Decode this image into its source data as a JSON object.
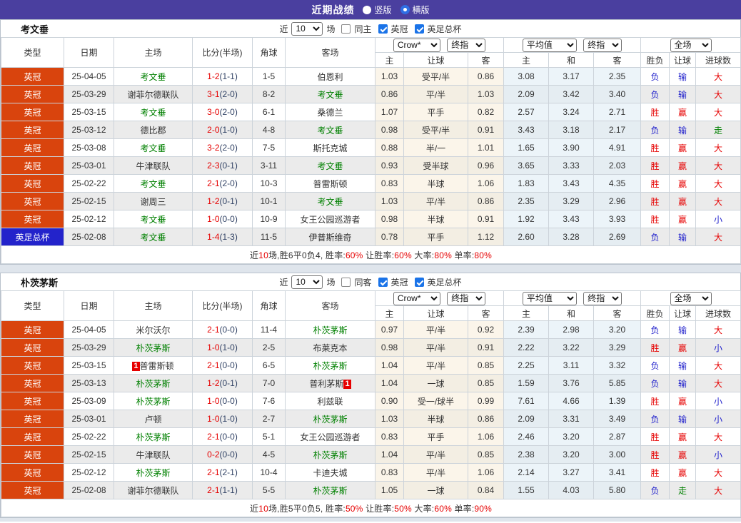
{
  "title_bar": {
    "title": "近期战绩",
    "radio_vertical_label": "竖版",
    "radio_horizontal_label": "横版",
    "selected_layout": "横版"
  },
  "controls": {
    "near_label": "近",
    "count_value": "10",
    "games_label": "场",
    "league_label": "英冠",
    "cup_label": "英足总杯"
  },
  "columns": {
    "type": "类型",
    "date": "日期",
    "home": "主场",
    "score": "比分(半场)",
    "corners": "角球",
    "away": "客场",
    "asia_home": "主",
    "asia_handicap": "让球",
    "asia_away": "客",
    "euro_home": "主",
    "euro_draw": "和",
    "euro_away": "客",
    "result_wl": "胜负",
    "result_handicap": "让球",
    "result_goals": "进球数",
    "select_bookmaker": "Crow*",
    "select_final_a": "终指",
    "select_average": "平均值",
    "select_final_b": "终指",
    "select_scope": "全场"
  },
  "colors": {
    "header_bg": "#4a3f9f",
    "league_bg": "#d9440d",
    "cup_bg": "#2323cb",
    "focus_team_green": "#008000",
    "win_red": "#e60000",
    "loss_blue": "#2222cc",
    "push_green": "#008000"
  },
  "tables": [
    {
      "team": "考文垂",
      "same_label": "同主",
      "rows": [
        {
          "type": "英冠",
          "cup": false,
          "date": "25-04-05",
          "home": "考文垂",
          "home_focus": true,
          "home_badge": "",
          "score_ft": "1-2",
          "score_ht": "(1-1)",
          "corners": "1-5",
          "away": "伯恩利",
          "away_focus": false,
          "away_badge": "",
          "asia": [
            "1.03",
            "受平/半",
            "0.86"
          ],
          "euro": [
            "3.08",
            "3.17",
            "2.35"
          ],
          "results": [
            "负",
            "输",
            "大"
          ]
        },
        {
          "type": "英冠",
          "cup": false,
          "date": "25-03-29",
          "home": "谢菲尔德联队",
          "home_focus": false,
          "home_badge": "",
          "score_ft": "3-1",
          "score_ht": "(2-0)",
          "corners": "8-2",
          "away": "考文垂",
          "away_focus": true,
          "away_badge": "",
          "asia": [
            "0.86",
            "平/半",
            "1.03"
          ],
          "euro": [
            "2.09",
            "3.42",
            "3.40"
          ],
          "results": [
            "负",
            "输",
            "大"
          ]
        },
        {
          "type": "英冠",
          "cup": false,
          "date": "25-03-15",
          "home": "考文垂",
          "home_focus": true,
          "home_badge": "",
          "score_ft": "3-0",
          "score_ht": "(2-0)",
          "corners": "6-1",
          "away": "桑德兰",
          "away_focus": false,
          "away_badge": "",
          "asia": [
            "1.07",
            "平手",
            "0.82"
          ],
          "euro": [
            "2.57",
            "3.24",
            "2.71"
          ],
          "results": [
            "胜",
            "赢",
            "大"
          ]
        },
        {
          "type": "英冠",
          "cup": false,
          "date": "25-03-12",
          "home": "德比郡",
          "home_focus": false,
          "home_badge": "",
          "score_ft": "2-0",
          "score_ht": "(1-0)",
          "corners": "4-8",
          "away": "考文垂",
          "away_focus": true,
          "away_badge": "",
          "asia": [
            "0.98",
            "受平/半",
            "0.91"
          ],
          "euro": [
            "3.43",
            "3.18",
            "2.17"
          ],
          "results": [
            "负",
            "输",
            "走"
          ]
        },
        {
          "type": "英冠",
          "cup": false,
          "date": "25-03-08",
          "home": "考文垂",
          "home_focus": true,
          "home_badge": "",
          "score_ft": "3-2",
          "score_ht": "(2-0)",
          "corners": "7-5",
          "away": "斯托克城",
          "away_focus": false,
          "away_badge": "",
          "asia": [
            "0.88",
            "半/一",
            "1.01"
          ],
          "euro": [
            "1.65",
            "3.90",
            "4.91"
          ],
          "results": [
            "胜",
            "赢",
            "大"
          ]
        },
        {
          "type": "英冠",
          "cup": false,
          "date": "25-03-01",
          "home": "牛津联队",
          "home_focus": false,
          "home_badge": "",
          "score_ft": "2-3",
          "score_ht": "(0-1)",
          "corners": "3-11",
          "away": "考文垂",
          "away_focus": true,
          "away_badge": "",
          "asia": [
            "0.93",
            "受半球",
            "0.96"
          ],
          "euro": [
            "3.65",
            "3.33",
            "2.03"
          ],
          "results": [
            "胜",
            "赢",
            "大"
          ]
        },
        {
          "type": "英冠",
          "cup": false,
          "date": "25-02-22",
          "home": "考文垂",
          "home_focus": true,
          "home_badge": "",
          "score_ft": "2-1",
          "score_ht": "(2-0)",
          "corners": "10-3",
          "away": "普雷斯顿",
          "away_focus": false,
          "away_badge": "",
          "asia": [
            "0.83",
            "半球",
            "1.06"
          ],
          "euro": [
            "1.83",
            "3.43",
            "4.35"
          ],
          "results": [
            "胜",
            "赢",
            "大"
          ]
        },
        {
          "type": "英冠",
          "cup": false,
          "date": "25-02-15",
          "home": "谢周三",
          "home_focus": false,
          "home_badge": "",
          "score_ft": "1-2",
          "score_ht": "(0-1)",
          "corners": "10-1",
          "away": "考文垂",
          "away_focus": true,
          "away_badge": "",
          "asia": [
            "1.03",
            "平/半",
            "0.86"
          ],
          "euro": [
            "2.35",
            "3.29",
            "2.96"
          ],
          "results": [
            "胜",
            "赢",
            "大"
          ]
        },
        {
          "type": "英冠",
          "cup": false,
          "date": "25-02-12",
          "home": "考文垂",
          "home_focus": true,
          "home_badge": "",
          "score_ft": "1-0",
          "score_ht": "(0-0)",
          "corners": "10-9",
          "away": "女王公园巡游者",
          "away_focus": false,
          "away_badge": "",
          "asia": [
            "0.98",
            "半球",
            "0.91"
          ],
          "euro": [
            "1.92",
            "3.43",
            "3.93"
          ],
          "results": [
            "胜",
            "赢",
            "小"
          ]
        },
        {
          "type": "英足总杯",
          "cup": true,
          "date": "25-02-08",
          "home": "考文垂",
          "home_focus": true,
          "home_badge": "",
          "score_ft": "1-4",
          "score_ht": "(1-3)",
          "corners": "11-5",
          "away": "伊普斯维奇",
          "away_focus": false,
          "away_badge": "",
          "asia": [
            "0.78",
            "平手",
            "1.12"
          ],
          "euro": [
            "2.60",
            "3.28",
            "2.69"
          ],
          "results": [
            "负",
            "输",
            "大"
          ]
        }
      ],
      "summary": [
        [
          "近",
          false
        ],
        [
          "10",
          true
        ],
        [
          "场,胜6平0负4, 胜率:",
          false
        ],
        [
          "60%",
          true
        ],
        [
          " 让胜率:",
          false
        ],
        [
          "60%",
          true
        ],
        [
          " 大率:",
          false
        ],
        [
          "80%",
          true
        ],
        [
          " 单率:",
          false
        ],
        [
          "80%",
          true
        ]
      ]
    },
    {
      "team": "朴茨茅斯",
      "same_label": "同客",
      "rows": [
        {
          "type": "英冠",
          "cup": false,
          "date": "25-04-05",
          "home": "米尔沃尔",
          "home_focus": false,
          "home_badge": "",
          "score_ft": "2-1",
          "score_ht": "(0-0)",
          "corners": "11-4",
          "away": "朴茨茅斯",
          "away_focus": true,
          "away_badge": "",
          "asia": [
            "0.97",
            "平/半",
            "0.92"
          ],
          "euro": [
            "2.39",
            "2.98",
            "3.20"
          ],
          "results": [
            "负",
            "输",
            "大"
          ]
        },
        {
          "type": "英冠",
          "cup": false,
          "date": "25-03-29",
          "home": "朴茨茅斯",
          "home_focus": true,
          "home_badge": "",
          "score_ft": "1-0",
          "score_ht": "(1-0)",
          "corners": "2-5",
          "away": "布莱克本",
          "away_focus": false,
          "away_badge": "",
          "asia": [
            "0.98",
            "平/半",
            "0.91"
          ],
          "euro": [
            "2.22",
            "3.22",
            "3.29"
          ],
          "results": [
            "胜",
            "赢",
            "小"
          ]
        },
        {
          "type": "英冠",
          "cup": false,
          "date": "25-03-15",
          "home": "普雷斯顿",
          "home_focus": false,
          "home_badge": "1",
          "score_ft": "2-1",
          "score_ht": "(0-0)",
          "corners": "6-5",
          "away": "朴茨茅斯",
          "away_focus": true,
          "away_badge": "",
          "asia": [
            "1.04",
            "平/半",
            "0.85"
          ],
          "euro": [
            "2.25",
            "3.11",
            "3.32"
          ],
          "results": [
            "负",
            "输",
            "大"
          ]
        },
        {
          "type": "英冠",
          "cup": false,
          "date": "25-03-13",
          "home": "朴茨茅斯",
          "home_focus": true,
          "home_badge": "",
          "score_ft": "1-2",
          "score_ht": "(0-1)",
          "corners": "7-0",
          "away": "普利茅斯",
          "away_focus": false,
          "away_badge": "1",
          "asia": [
            "1.04",
            "一球",
            "0.85"
          ],
          "euro": [
            "1.59",
            "3.76",
            "5.85"
          ],
          "results": [
            "负",
            "输",
            "大"
          ]
        },
        {
          "type": "英冠",
          "cup": false,
          "date": "25-03-09",
          "home": "朴茨茅斯",
          "home_focus": true,
          "home_badge": "",
          "score_ft": "1-0",
          "score_ht": "(0-0)",
          "corners": "7-6",
          "away": "利兹联",
          "away_focus": false,
          "away_badge": "",
          "asia": [
            "0.90",
            "受一/球半",
            "0.99"
          ],
          "euro": [
            "7.61",
            "4.66",
            "1.39"
          ],
          "results": [
            "胜",
            "赢",
            "小"
          ]
        },
        {
          "type": "英冠",
          "cup": false,
          "date": "25-03-01",
          "home": "卢顿",
          "home_focus": false,
          "home_badge": "",
          "score_ft": "1-0",
          "score_ht": "(1-0)",
          "corners": "2-7",
          "away": "朴茨茅斯",
          "away_focus": true,
          "away_badge": "",
          "asia": [
            "1.03",
            "半球",
            "0.86"
          ],
          "euro": [
            "2.09",
            "3.31",
            "3.49"
          ],
          "results": [
            "负",
            "输",
            "小"
          ]
        },
        {
          "type": "英冠",
          "cup": false,
          "date": "25-02-22",
          "home": "朴茨茅斯",
          "home_focus": true,
          "home_badge": "",
          "score_ft": "2-1",
          "score_ht": "(0-0)",
          "corners": "5-1",
          "away": "女王公园巡游者",
          "away_focus": false,
          "away_badge": "",
          "asia": [
            "0.83",
            "平手",
            "1.06"
          ],
          "euro": [
            "2.46",
            "3.20",
            "2.87"
          ],
          "results": [
            "胜",
            "赢",
            "大"
          ]
        },
        {
          "type": "英冠",
          "cup": false,
          "date": "25-02-15",
          "home": "牛津联队",
          "home_focus": false,
          "home_badge": "",
          "score_ft": "0-2",
          "score_ht": "(0-0)",
          "corners": "4-5",
          "away": "朴茨茅斯",
          "away_focus": true,
          "away_badge": "",
          "asia": [
            "1.04",
            "平/半",
            "0.85"
          ],
          "euro": [
            "2.38",
            "3.20",
            "3.00"
          ],
          "results": [
            "胜",
            "赢",
            "小"
          ]
        },
        {
          "type": "英冠",
          "cup": false,
          "date": "25-02-12",
          "home": "朴茨茅斯",
          "home_focus": true,
          "home_badge": "",
          "score_ft": "2-1",
          "score_ht": "(2-1)",
          "corners": "10-4",
          "away": "卡迪夫城",
          "away_focus": false,
          "away_badge": "",
          "asia": [
            "0.83",
            "平/半",
            "1.06"
          ],
          "euro": [
            "2.14",
            "3.27",
            "3.41"
          ],
          "results": [
            "胜",
            "赢",
            "大"
          ]
        },
        {
          "type": "英冠",
          "cup": false,
          "date": "25-02-08",
          "home": "谢菲尔德联队",
          "home_focus": false,
          "home_badge": "",
          "score_ft": "2-1",
          "score_ht": "(1-1)",
          "corners": "5-5",
          "away": "朴茨茅斯",
          "away_focus": true,
          "away_badge": "",
          "asia": [
            "1.05",
            "一球",
            "0.84"
          ],
          "euro": [
            "1.55",
            "4.03",
            "5.80"
          ],
          "results": [
            "负",
            "走",
            "大"
          ]
        }
      ],
      "summary": [
        [
          "近",
          false
        ],
        [
          "10",
          true
        ],
        [
          "场,胜5平0负5, 胜率:",
          false
        ],
        [
          "50%",
          true
        ],
        [
          " 让胜率:",
          false
        ],
        [
          "50%",
          true
        ],
        [
          " 大率:",
          false
        ],
        [
          "60%",
          true
        ],
        [
          " 单率:",
          false
        ],
        [
          "90%",
          true
        ]
      ]
    }
  ]
}
